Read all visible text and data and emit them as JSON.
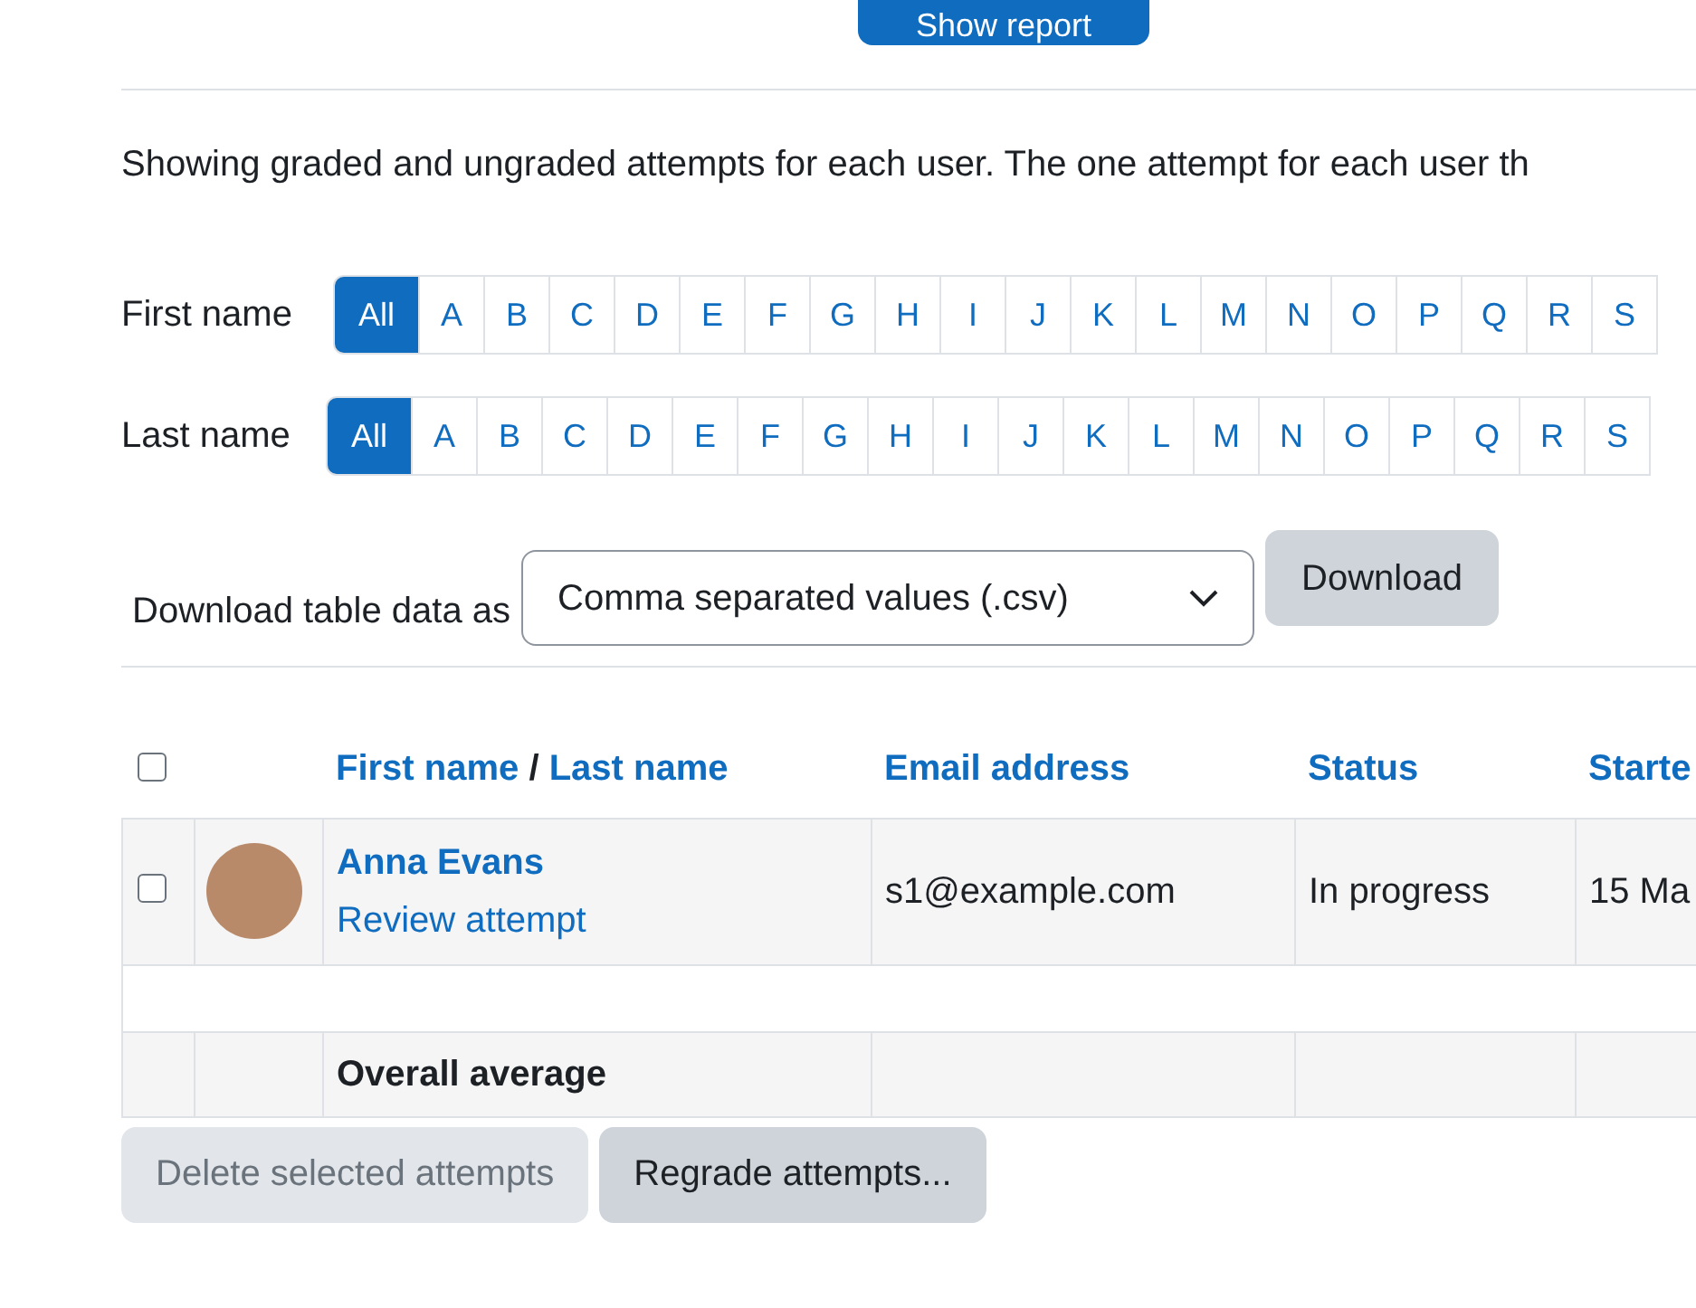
{
  "show_report_button": "Show report",
  "description": "Showing graded and ungraded attempts for each user. The one attempt for each user th",
  "initials_bars": [
    {
      "label": "First name",
      "letters": [
        {
          "text": "All",
          "selected": true
        },
        {
          "text": "A",
          "selected": false
        },
        {
          "text": "B",
          "selected": false
        },
        {
          "text": "C",
          "selected": false
        },
        {
          "text": "D",
          "selected": false
        },
        {
          "text": "E",
          "selected": false
        },
        {
          "text": "F",
          "selected": false
        },
        {
          "text": "G",
          "selected": false
        },
        {
          "text": "H",
          "selected": false
        },
        {
          "text": "I",
          "selected": false
        },
        {
          "text": "J",
          "selected": false
        },
        {
          "text": "K",
          "selected": false
        },
        {
          "text": "L",
          "selected": false
        },
        {
          "text": "M",
          "selected": false
        },
        {
          "text": "N",
          "selected": false
        },
        {
          "text": "O",
          "selected": false
        },
        {
          "text": "P",
          "selected": false
        },
        {
          "text": "Q",
          "selected": false
        },
        {
          "text": "R",
          "selected": false
        },
        {
          "text": "S",
          "selected": false
        }
      ]
    },
    {
      "label": "Last name",
      "letters": [
        {
          "text": "All",
          "selected": true
        },
        {
          "text": "A",
          "selected": false
        },
        {
          "text": "B",
          "selected": false
        },
        {
          "text": "C",
          "selected": false
        },
        {
          "text": "D",
          "selected": false
        },
        {
          "text": "E",
          "selected": false
        },
        {
          "text": "F",
          "selected": false
        },
        {
          "text": "G",
          "selected": false
        },
        {
          "text": "H",
          "selected": false
        },
        {
          "text": "I",
          "selected": false
        },
        {
          "text": "J",
          "selected": false
        },
        {
          "text": "K",
          "selected": false
        },
        {
          "text": "L",
          "selected": false
        },
        {
          "text": "M",
          "selected": false
        },
        {
          "text": "N",
          "selected": false
        },
        {
          "text": "O",
          "selected": false
        },
        {
          "text": "P",
          "selected": false
        },
        {
          "text": "Q",
          "selected": false
        },
        {
          "text": "R",
          "selected": false
        },
        {
          "text": "S",
          "selected": false
        }
      ]
    }
  ],
  "download": {
    "label": "Download table data as",
    "format": "Comma separated values (.csv)",
    "button": "Download"
  },
  "table": {
    "select_all_checked": false,
    "header": {
      "first_name": "First name",
      "separator": "/",
      "last_name": "Last name",
      "columns": [
        "Email address",
        "Status",
        "Starte"
      ]
    },
    "rows": [
      {
        "checked": false,
        "name": "Anna Evans",
        "link": "Review attempt",
        "cells": [
          "s1@example.com",
          "In progress",
          "15 Ma"
        ]
      }
    ],
    "average_label": "Overall average"
  },
  "actions": [
    {
      "label": "Delete selected attempts",
      "disabled": true
    },
    {
      "label": "Regrade attempts...",
      "disabled": false
    }
  ]
}
